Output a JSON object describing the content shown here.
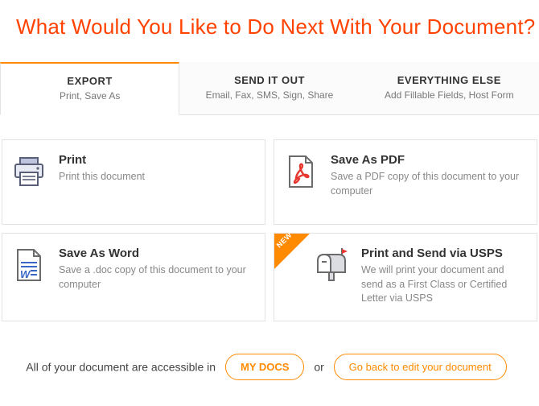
{
  "title": "What Would You Like to Do Next With Your Document?",
  "tabs": [
    {
      "label": "EXPORT",
      "sub": "Print, Save As",
      "active": true
    },
    {
      "label": "SEND IT OUT",
      "sub": "Email, Fax, SMS, Sign, Share",
      "active": false
    },
    {
      "label": "EVERYTHING ELSE",
      "sub": "Add Fillable Fields, Host Form",
      "active": false
    }
  ],
  "tiles": {
    "print": {
      "title": "Print",
      "desc": "Print this document"
    },
    "save_pdf": {
      "title": "Save As PDF",
      "desc": "Save a PDF copy of this document to your computer"
    },
    "save_word": {
      "title": "Save As Word",
      "desc": "Save a .doc copy of this document to your computer"
    },
    "usps": {
      "title": "Print and Send via USPS",
      "desc": "We will print your document and send as a First Class or Certified Letter via USPS",
      "badge": "NEW"
    }
  },
  "footer": {
    "pre": "All of your document are accessible in",
    "mydocs": "MY DOCS",
    "mid": "or",
    "goback": "Go back to edit your document"
  }
}
